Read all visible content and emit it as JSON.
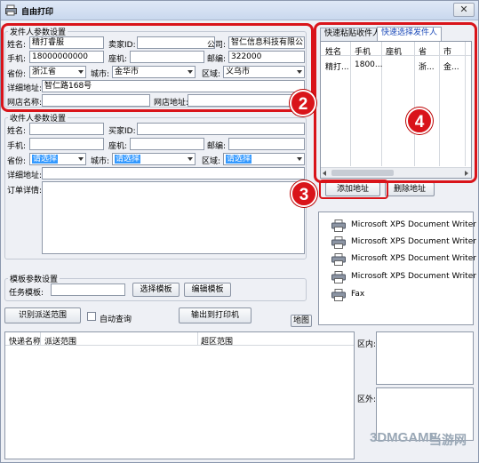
{
  "window": {
    "title": "自由打印",
    "close_label": "✕"
  },
  "sender": {
    "group_title": "发件人参数设置",
    "name_label": "姓名:",
    "name_value": "精打睿服",
    "seller_label": "卖家ID:",
    "seller_value": "",
    "company_label": "公司:",
    "company_value": "智仁信息科技有限公司",
    "mobile_label": "手机:",
    "mobile_value": "18000000000",
    "phone_label": "座机:",
    "phone_value": "",
    "zip_label": "邮编:",
    "zip_value": "322000",
    "province_label": "省份:",
    "province_value": "浙江省",
    "city_label": "城市:",
    "city_value": "金华市",
    "district_label": "区域:",
    "district_value": "义乌市",
    "address_label": "详细地址:",
    "address_value": "智仁路168号",
    "shop_label": "网店名称:",
    "shop_value": "",
    "shop_url_label": "网店地址:",
    "shop_url_value": ""
  },
  "receiver": {
    "group_title": "收件人参数设置",
    "name_label": "姓名:",
    "buyer_label": "买家ID:",
    "mobile_label": "手机:",
    "phone_label": "座机:",
    "zip_label": "邮编:",
    "province_label": "省份:",
    "province_value": "请选择",
    "city_label": "城市:",
    "city_value": "请选择",
    "district_label": "区域:",
    "district_value": "请选择",
    "address_label": "详细地址:",
    "detail_label": "订单详情:"
  },
  "template": {
    "group_title": "模板参数设置",
    "task_label": "任务模板:",
    "task_value": "",
    "choose_button": "选择模板",
    "edit_button": "编辑模板"
  },
  "actions": {
    "identify_button": "识别派送范围",
    "auto_query_label": "自动查询",
    "output_button": "输出到打印机",
    "map_button": "地图"
  },
  "right_tabs": {
    "tab1": "快速粘贴收件人",
    "tab2": "快速选择发件人"
  },
  "sender_table": {
    "headers": [
      "姓名",
      "手机",
      "座机",
      "省",
      "市"
    ],
    "row": [
      "精打...",
      "1800...",
      "",
      "浙...",
      "金..."
    ]
  },
  "address_buttons": {
    "add": "添加地址",
    "delete": "删除地址"
  },
  "printers": [
    "Microsoft XPS Document Writer P",
    "Microsoft XPS Document Writer P",
    "Microsoft XPS Document Writer P",
    "Microsoft XPS Document Writer",
    "Fax"
  ],
  "delivery_table": {
    "headers": [
      "快递名称",
      "派送范围",
      "超区范围"
    ]
  },
  "range": {
    "inside_label": "区内:",
    "outside_label": "区外:"
  },
  "badges": [
    "2",
    "3",
    "4"
  ],
  "watermark": {
    "brand": "3DMGAME",
    "site": "当游网"
  },
  "colors": {
    "annotation_red": "#d9141a",
    "selection_blue": "#3399ff",
    "tab_active_text": "#1a48b8"
  }
}
